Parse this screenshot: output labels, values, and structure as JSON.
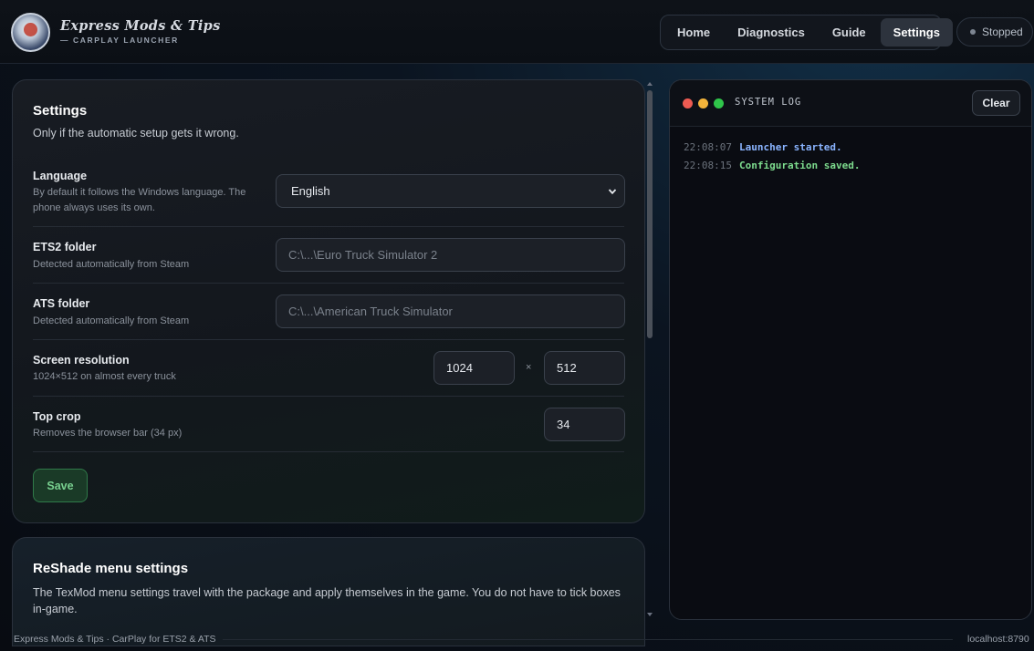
{
  "brand": {
    "title": "Express Mods & Tips",
    "subtitle": "— CARPLAY LAUNCHER"
  },
  "nav": {
    "tabs": [
      {
        "label": "Home",
        "active": false
      },
      {
        "label": "Diagnostics",
        "active": false
      },
      {
        "label": "Guide",
        "active": false
      },
      {
        "label": "Settings",
        "active": true
      }
    ]
  },
  "status": {
    "label": "Stopped"
  },
  "settings": {
    "title": "Settings",
    "subtitle": "Only if the automatic setup gets it wrong.",
    "language": {
      "label": "Language",
      "hint": "By default it follows the Windows language. The phone always uses its own.",
      "value": "English"
    },
    "ets2": {
      "label": "ETS2 folder",
      "hint": "Detected automatically from Steam",
      "placeholder": "C:\\...\\Euro Truck Simulator 2"
    },
    "ats": {
      "label": "ATS folder",
      "hint": "Detected automatically from Steam",
      "placeholder": "C:\\...\\American Truck Simulator"
    },
    "resolution": {
      "label": "Screen resolution",
      "hint": "1024×512 on almost every truck",
      "width": "1024",
      "separator": "×",
      "height": "512"
    },
    "crop": {
      "label": "Top crop",
      "hint": "Removes the browser bar (34 px)",
      "value": "34"
    },
    "save_label": "Save"
  },
  "reshade": {
    "title": "ReShade menu settings",
    "description": "The TexMod menu settings travel with the package and apply themselves in the game. You do not have to tick boxes in-game."
  },
  "log": {
    "title": "SYSTEM LOG",
    "clear_label": "Clear",
    "entries": [
      {
        "time": "22:08:07",
        "message": "Launcher started.",
        "level": "info"
      },
      {
        "time": "22:08:15",
        "message": "Configuration saved.",
        "level": "ok"
      }
    ]
  },
  "footer": {
    "left": "Express Mods & Tips · CarPlay for ETS2 & ATS",
    "right": "localhost:8790"
  },
  "colors": {
    "accent_green": "#78d08f",
    "log_info": "#8ab4ff",
    "log_ok": "#7ddc8e"
  }
}
